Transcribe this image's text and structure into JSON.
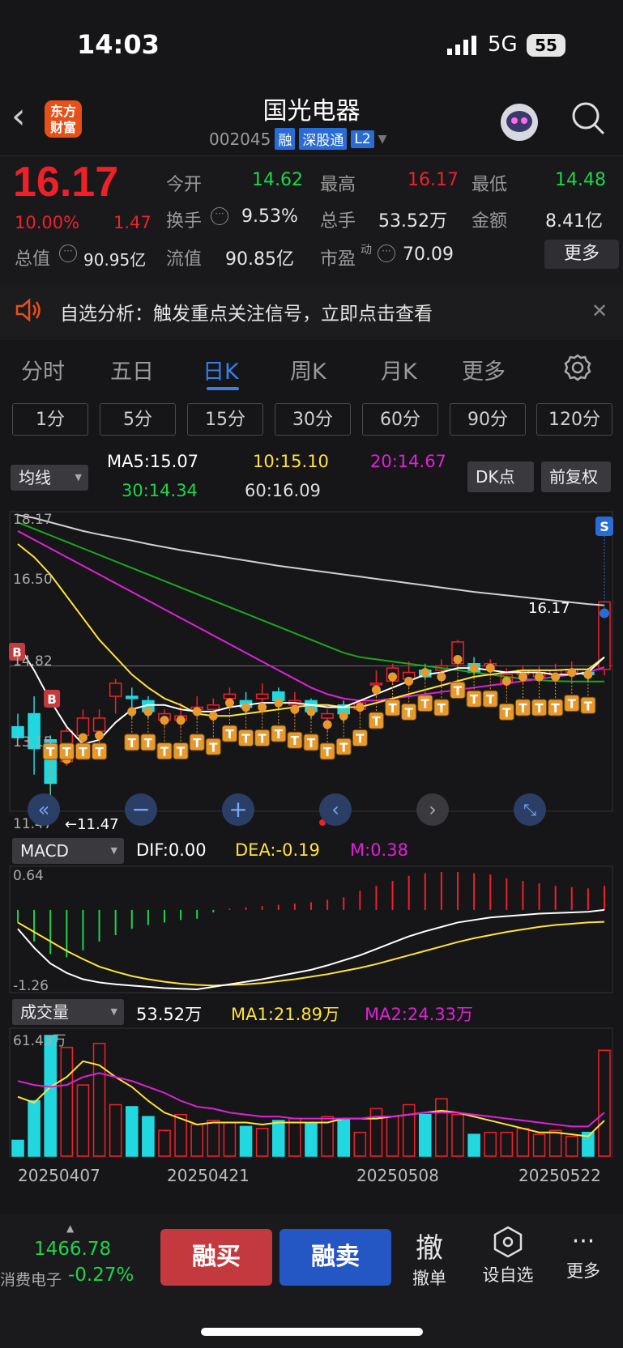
{
  "status": {
    "time": "14:03",
    "network": "5G",
    "battery": "55"
  },
  "header": {
    "logo_line1": "东方",
    "logo_line2": "财富",
    "name": "国光电器",
    "code": "002045",
    "tags": [
      "融",
      "深股通",
      "L2"
    ]
  },
  "quote": {
    "price": "16.17",
    "change_pct": "10.00%",
    "change": "1.47",
    "open_label": "今开",
    "open": "14.62",
    "high_label": "最高",
    "high": "16.17",
    "low_label": "最低",
    "low": "14.48",
    "turnover_label": "换手",
    "turnover": "9.53%",
    "volume_label": "总手",
    "volume": "53.52万",
    "amount_label": "金额",
    "amount": "8.41亿",
    "mktcap_label": "总值",
    "mktcap": "90.95亿",
    "float_label": "流值",
    "float": "90.85亿",
    "pe_label": "市盈",
    "pe_sup": "动",
    "pe": "70.09",
    "more": "更多"
  },
  "notice": {
    "text": "自选分析：触发重点关注信号，立即点击查看"
  },
  "period_tabs": [
    "分时",
    "五日",
    "日K",
    "周K",
    "月K",
    "更多"
  ],
  "minute_buttons": [
    "1分",
    "5分",
    "15分",
    "30分",
    "60分",
    "90分",
    "120分"
  ],
  "kline": {
    "selector": "均线",
    "ma5": "MA5:15.07",
    "ma10": "10:15.10",
    "ma20": "20:14.67",
    "ma30": "30:14.34",
    "ma60": "60:16.09",
    "dk_label": "DK点",
    "adjust_label": "前复权",
    "y_labels": [
      "18.17",
      "16.50",
      "14.82",
      "13.15",
      "11.47"
    ],
    "low_mark": "←11.47",
    "last_mark": "16.17",
    "buy_mark": "B",
    "sell_mark": "S",
    "t_mark": "T"
  },
  "macd": {
    "selector": "MACD",
    "dif": "DIF:0.00",
    "dea": "DEA:-0.19",
    "m": "M:0.38",
    "y_max": "0.64",
    "y_min": "-1.26"
  },
  "volume": {
    "selector": "成交量",
    "value": "53.52万",
    "ma1": "MA1:21.89万",
    "ma2": "MA2:24.33万",
    "y_max": "61.43万"
  },
  "dates": [
    "20250407",
    "20250421",
    "20250508",
    "20250522"
  ],
  "colors": {
    "up": "#f0202a",
    "down": "#22d8e0",
    "ma5": "#ffffff",
    "ma10": "#ffe23a",
    "ma20": "#e020d8",
    "ma30": "#1aa81a",
    "ma60": "#d0d0d0",
    "accent": "#3a7ee6"
  },
  "chart_data": {
    "type": "candlestick",
    "title": "国光电器 日K",
    "candles": [
      {
        "o": 13.3,
        "h": 13.6,
        "l": 13.0,
        "c": 13.05
      },
      {
        "o": 13.6,
        "h": 14.0,
        "l": 12.2,
        "c": 12.8
      },
      {
        "o": 13.0,
        "h": 13.1,
        "l": 11.47,
        "c": 12.0
      },
      {
        "o": 12.5,
        "h": 13.3,
        "l": 12.4,
        "c": 13.2
      },
      {
        "o": 13.1,
        "h": 13.7,
        "l": 12.9,
        "c": 13.5
      },
      {
        "o": 13.2,
        "h": 13.7,
        "l": 12.95,
        "c": 13.5
      },
      {
        "o": 14.0,
        "h": 14.4,
        "l": 13.6,
        "c": 14.3
      },
      {
        "o": 14.0,
        "h": 14.2,
        "l": 13.5,
        "c": 13.95
      },
      {
        "o": 13.9,
        "h": 14.0,
        "l": 13.5,
        "c": 13.65
      },
      {
        "o": 13.45,
        "h": 13.7,
        "l": 13.3,
        "c": 13.6
      },
      {
        "o": 13.45,
        "h": 13.85,
        "l": 13.3,
        "c": 13.55
      },
      {
        "o": 13.7,
        "h": 14.0,
        "l": 13.5,
        "c": 13.75
      },
      {
        "o": 13.7,
        "h": 13.95,
        "l": 13.4,
        "c": 13.8
      },
      {
        "o": 13.95,
        "h": 14.2,
        "l": 13.7,
        "c": 14.05
      },
      {
        "o": 13.9,
        "h": 14.1,
        "l": 13.6,
        "c": 13.75
      },
      {
        "o": 13.95,
        "h": 14.3,
        "l": 13.6,
        "c": 14.05
      },
      {
        "o": 14.1,
        "h": 14.2,
        "l": 13.7,
        "c": 13.9
      },
      {
        "o": 13.8,
        "h": 14.1,
        "l": 13.55,
        "c": 13.9
      },
      {
        "o": 13.9,
        "h": 13.95,
        "l": 13.5,
        "c": 13.65
      },
      {
        "o": 13.5,
        "h": 13.7,
        "l": 13.2,
        "c": 13.6
      },
      {
        "o": 13.8,
        "h": 13.9,
        "l": 13.4,
        "c": 13.6
      },
      {
        "o": 13.7,
        "h": 13.9,
        "l": 13.6,
        "c": 13.85
      },
      {
        "o": 14.3,
        "h": 14.6,
        "l": 14.0,
        "c": 14.3
      },
      {
        "o": 14.35,
        "h": 14.75,
        "l": 14.3,
        "c": 14.65
      },
      {
        "o": 14.4,
        "h": 14.8,
        "l": 14.2,
        "c": 14.55
      },
      {
        "o": 14.6,
        "h": 14.75,
        "l": 14.4,
        "c": 14.45
      },
      {
        "o": 14.6,
        "h": 14.85,
        "l": 14.3,
        "c": 14.7
      },
      {
        "o": 14.75,
        "h": 15.3,
        "l": 14.7,
        "c": 15.25
      },
      {
        "o": 14.75,
        "h": 14.9,
        "l": 14.5,
        "c": 14.55
      },
      {
        "o": 14.7,
        "h": 14.85,
        "l": 14.5,
        "c": 14.75
      },
      {
        "o": 14.3,
        "h": 14.65,
        "l": 14.2,
        "c": 14.5
      },
      {
        "o": 14.5,
        "h": 14.7,
        "l": 14.3,
        "c": 14.6
      },
      {
        "o": 14.45,
        "h": 14.7,
        "l": 14.3,
        "c": 14.55
      },
      {
        "o": 14.5,
        "h": 14.75,
        "l": 14.3,
        "c": 14.6
      },
      {
        "o": 14.55,
        "h": 14.8,
        "l": 14.4,
        "c": 14.62
      },
      {
        "o": 14.55,
        "h": 14.65,
        "l": 14.35,
        "c": 14.5
      },
      {
        "o": 14.62,
        "h": 16.17,
        "l": 14.48,
        "c": 16.17
      }
    ],
    "ma5": [
      15.2,
      14.6,
      13.9,
      13.3,
      12.9,
      13.0,
      13.4,
      13.7,
      13.8,
      13.8,
      13.7,
      13.65,
      13.65,
      13.75,
      13.8,
      13.85,
      13.85,
      13.85,
      13.8,
      13.75,
      13.75,
      13.9,
      14.05,
      14.2,
      14.35,
      14.5,
      14.55,
      14.65,
      14.65,
      14.6,
      14.55,
      14.55,
      14.55,
      14.5,
      14.5,
      14.55,
      14.9
    ],
    "ma10": [
      17.5,
      17.2,
      16.8,
      16.3,
      15.8,
      15.3,
      14.9,
      14.5,
      14.2,
      13.95,
      13.8,
      13.6,
      13.55,
      13.55,
      13.6,
      13.65,
      13.7,
      13.75,
      13.8,
      13.8,
      13.75,
      13.75,
      13.85,
      13.95,
      14.05,
      14.15,
      14.25,
      14.35,
      14.45,
      14.5,
      14.55,
      14.6,
      14.6,
      14.6,
      14.62,
      14.62,
      14.9
    ],
    "ma20": [
      17.8,
      17.6,
      17.4,
      17.2,
      17.0,
      16.8,
      16.6,
      16.4,
      16.2,
      16.0,
      15.8,
      15.6,
      15.4,
      15.2,
      15.0,
      14.8,
      14.6,
      14.4,
      14.2,
      14.05,
      13.95,
      13.9,
      13.9,
      13.95,
      14.0,
      14.05,
      14.1,
      14.15,
      14.2,
      14.25,
      14.3,
      14.35,
      14.4,
      14.45,
      14.5,
      14.55,
      14.67
    ],
    "ma30": [
      18.0,
      17.85,
      17.7,
      17.55,
      17.4,
      17.25,
      17.1,
      16.95,
      16.8,
      16.65,
      16.5,
      16.35,
      16.2,
      16.05,
      15.9,
      15.75,
      15.6,
      15.45,
      15.3,
      15.15,
      15.0,
      14.9,
      14.85,
      14.8,
      14.75,
      14.7,
      14.65,
      14.6,
      14.55,
      14.5,
      14.45,
      14.4,
      14.37,
      14.35,
      14.34,
      14.34,
      14.34
    ],
    "ma60": [
      18.17,
      18.1,
      18.0,
      17.9,
      17.8,
      17.72,
      17.65,
      17.58,
      17.5,
      17.43,
      17.36,
      17.3,
      17.24,
      17.18,
      17.12,
      17.06,
      17.0,
      16.95,
      16.9,
      16.85,
      16.8,
      16.75,
      16.7,
      16.65,
      16.6,
      16.55,
      16.5,
      16.45,
      16.4,
      16.36,
      16.32,
      16.28,
      16.24,
      16.2,
      16.16,
      16.12,
      16.09
    ],
    "volume": [
      8,
      28,
      61,
      55,
      36,
      57,
      26,
      25,
      20,
      13,
      21,
      16,
      18,
      17,
      15,
      14,
      18,
      19,
      17,
      20,
      19,
      12,
      24,
      20,
      26,
      21,
      29,
      21,
      11,
      12,
      12,
      14,
      11,
      13,
      10,
      12,
      53.52
    ],
    "vol_ma1": [
      30,
      27,
      35,
      40,
      48,
      46,
      40,
      35,
      28,
      22,
      19,
      16,
      17,
      17,
      17,
      16,
      17,
      17,
      17,
      17,
      19,
      19,
      19,
      20,
      21,
      22,
      23,
      22,
      20,
      18,
      16,
      14,
      12,
      12,
      11,
      10,
      18
    ],
    "vol_ma2": [
      38,
      36,
      35,
      36,
      40,
      42,
      40,
      38,
      35,
      32,
      28,
      25,
      24,
      22,
      21,
      20,
      20,
      19,
      19,
      19,
      19,
      19,
      20,
      20,
      21,
      22,
      22,
      22,
      21,
      20,
      19,
      18,
      17,
      16,
      15,
      15,
      22
    ],
    "macd_dif": [
      -0.3,
      -0.6,
      -0.85,
      -1.0,
      -1.1,
      -1.15,
      -1.18,
      -1.2,
      -1.22,
      -1.24,
      -1.25,
      -1.26,
      -1.22,
      -1.18,
      -1.14,
      -1.1,
      -1.05,
      -1.0,
      -0.95,
      -0.88,
      -0.8,
      -0.72,
      -0.62,
      -0.52,
      -0.42,
      -0.34,
      -0.27,
      -0.2,
      -0.16,
      -0.12,
      -0.1,
      -0.08,
      -0.06,
      -0.05,
      -0.04,
      -0.03,
      0.0
    ],
    "macd_dea": [
      -0.2,
      -0.35,
      -0.5,
      -0.65,
      -0.78,
      -0.9,
      -0.98,
      -1.05,
      -1.1,
      -1.14,
      -1.17,
      -1.19,
      -1.2,
      -1.19,
      -1.18,
      -1.16,
      -1.13,
      -1.1,
      -1.06,
      -1.02,
      -0.97,
      -0.92,
      -0.86,
      -0.79,
      -0.72,
      -0.65,
      -0.58,
      -0.51,
      -0.45,
      -0.4,
      -0.35,
      -0.31,
      -0.27,
      -0.24,
      -0.22,
      -0.2,
      -0.19
    ],
    "macd_m": [
      -0.2,
      -0.5,
      -0.7,
      -0.75,
      -0.64,
      -0.5,
      -0.4,
      -0.3,
      -0.24,
      -0.2,
      -0.16,
      -0.14,
      -0.04,
      0.02,
      0.04,
      0.06,
      0.08,
      0.1,
      0.12,
      0.16,
      0.2,
      0.3,
      0.38,
      0.46,
      0.54,
      0.58,
      0.6,
      0.6,
      0.58,
      0.56,
      0.5,
      0.46,
      0.42,
      0.38,
      0.36,
      0.34,
      0.38
    ],
    "price_ylim": [
      11.47,
      18.17
    ],
    "macd_ylim": [
      -1.26,
      0.64
    ],
    "vol_ylim": [
      0,
      61.43
    ]
  }
}
